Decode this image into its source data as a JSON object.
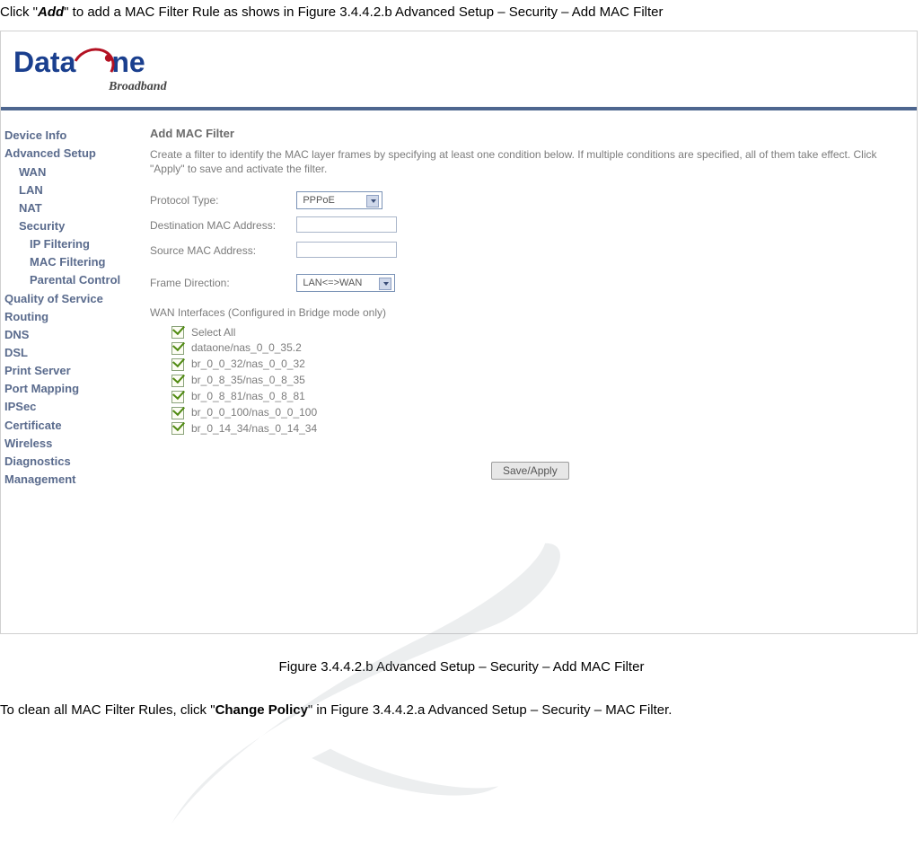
{
  "doc": {
    "click_pre": "Click \"",
    "add": "Add",
    "click_post": "\" to add a MAC Filter Rule as shows in Figure 3.4.4.2.b Advanced Setup – Security – Add MAC Filter",
    "caption": "Figure 3.4.4.2.b Advanced Setup – Security – Add MAC Filter",
    "clean_pre": "To clean all MAC Filter Rules, click \"",
    "change_policy": "Change Policy",
    "clean_post": "\" in Figure 3.4.4.2.a Advanced Setup – Security – MAC Filter."
  },
  "logo": {
    "brand": "Data",
    "brand2": "ne",
    "sub": "Broadband"
  },
  "sidebar": [
    {
      "label": "Device Info",
      "sub": false
    },
    {
      "label": "Advanced Setup",
      "sub": false
    },
    {
      "label": "WAN",
      "sub": true
    },
    {
      "label": "LAN",
      "sub": true
    },
    {
      "label": "NAT",
      "sub": true
    },
    {
      "label": "Security",
      "sub": true
    },
    {
      "label": "IP Filtering",
      "sub": true,
      "deep": true
    },
    {
      "label": "MAC Filtering",
      "sub": true,
      "deep": true
    },
    {
      "label": "Parental Control",
      "sub": true,
      "deep": true
    },
    {
      "label": "Quality of Service",
      "sub": false
    },
    {
      "label": "Routing",
      "sub": false
    },
    {
      "label": "DNS",
      "sub": false
    },
    {
      "label": "DSL",
      "sub": false
    },
    {
      "label": "Print Server",
      "sub": false
    },
    {
      "label": "Port Mapping",
      "sub": false
    },
    {
      "label": "IPSec",
      "sub": false
    },
    {
      "label": "Certificate",
      "sub": false
    },
    {
      "label": "Wireless",
      "sub": false
    },
    {
      "label": "Diagnostics",
      "sub": false
    },
    {
      "label": "Management",
      "sub": false
    }
  ],
  "panel": {
    "heading": "Add MAC Filter",
    "desc": "Create a filter to identify the MAC layer frames by specifying at least one condition below. If multiple conditions are specified, all of them take effect. Click \"Apply\" to save and activate the filter.",
    "protocol_label": "Protocol Type:",
    "protocol_value": "PPPoE",
    "dest_label": "Destination MAC Address:",
    "src_label": "Source MAC Address:",
    "frame_label": "Frame Direction:",
    "frame_value": "LAN<=>WAN",
    "wan_label": "WAN Interfaces (Configured in Bridge mode only)",
    "interfaces": [
      "Select All",
      "dataone/nas_0_0_35.2",
      "br_0_0_32/nas_0_0_32",
      "br_0_8_35/nas_0_8_35",
      "br_0_8_81/nas_0_8_81",
      "br_0_0_100/nas_0_0_100",
      "br_0_14_34/nas_0_14_34"
    ],
    "button": "Save/Apply"
  }
}
